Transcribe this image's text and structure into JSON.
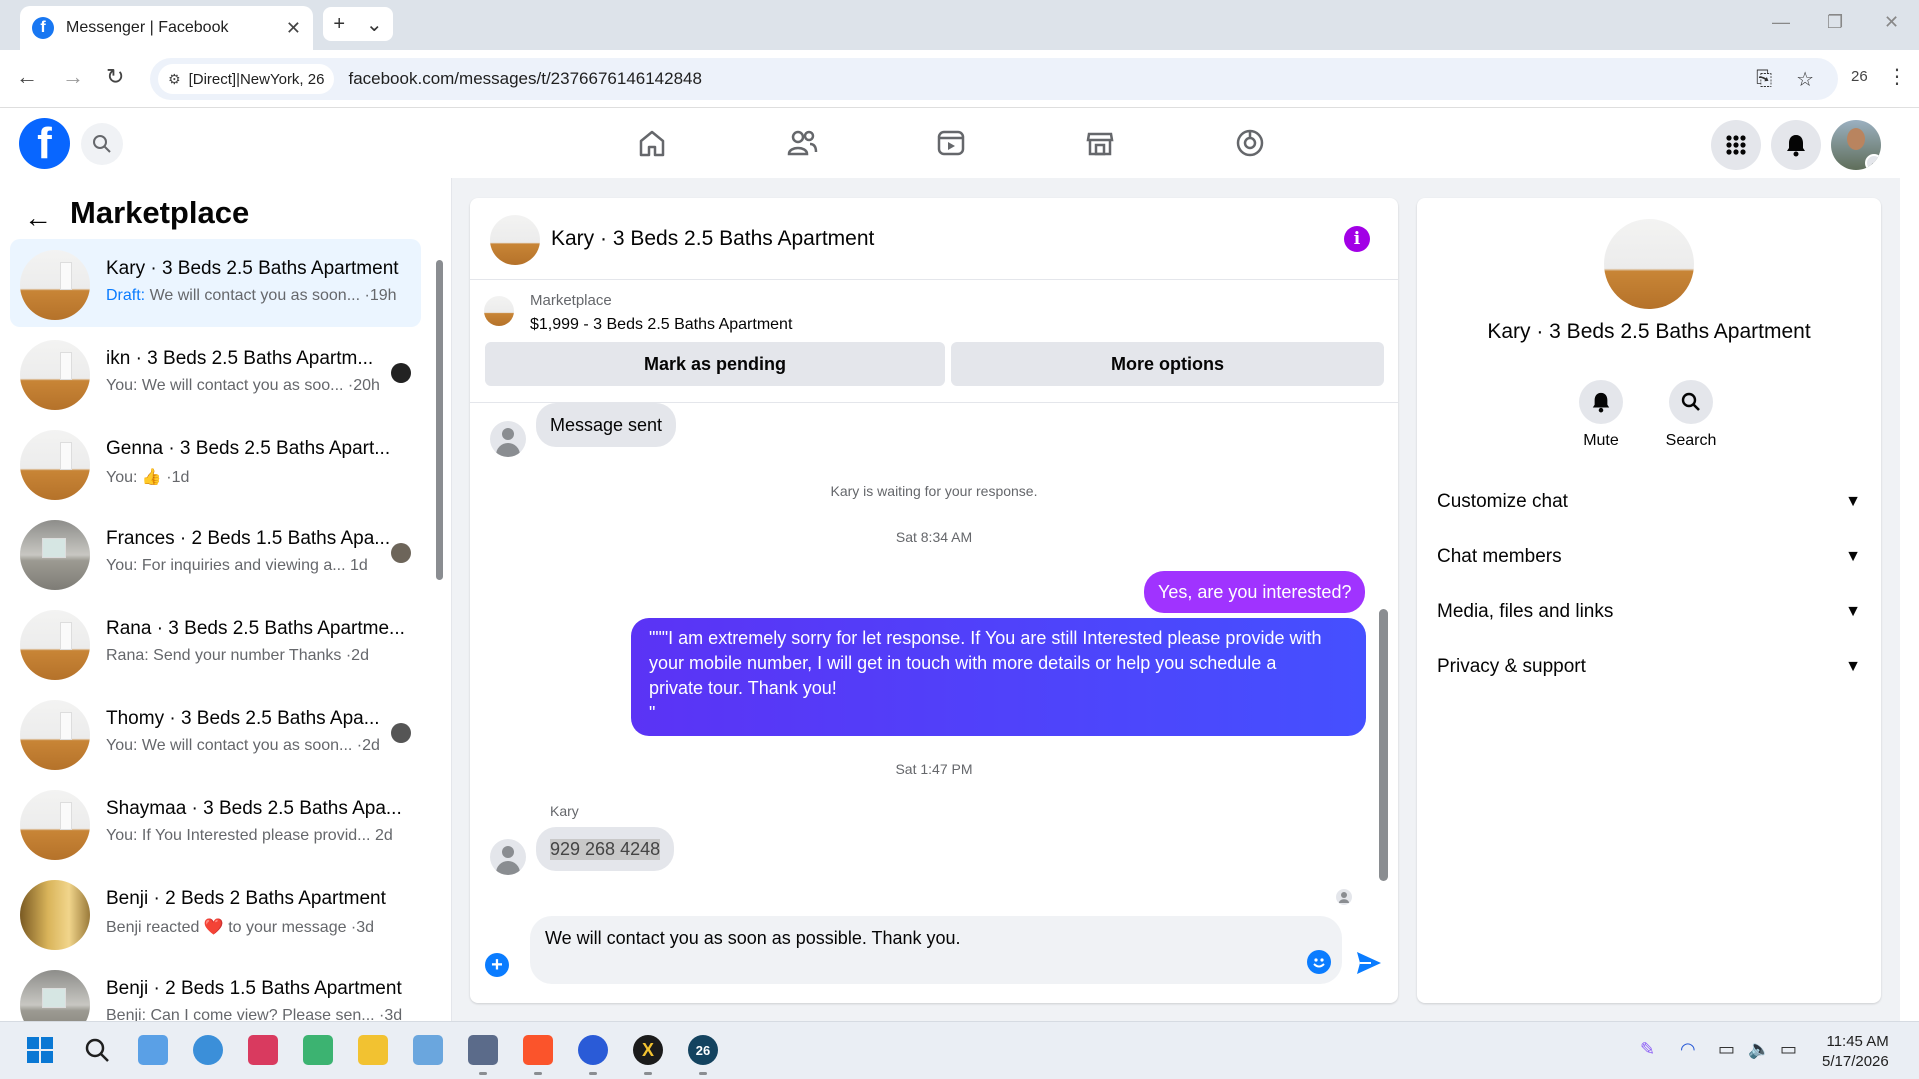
{
  "browser": {
    "tab_title": "Messenger | Facebook",
    "tab_close": "✕",
    "new_tab": "+",
    "tab_menu": "⌄",
    "site_chip": "[Direct]|NewYork, 26",
    "url": "facebook.com/messages/t/2376676146142848",
    "zoom_badge": "26"
  },
  "sidebar": {
    "title": "Marketplace",
    "conversations": [
      {
        "name": "Kary · 3 Beds 2.5 Baths Apartment",
        "preview_prefix": "Draft:",
        "preview": " We will contact you as soon... ·19h",
        "active": true
      },
      {
        "name": "ikn · 3 Beds 2.5 Baths Apartm...",
        "preview_prefix": "",
        "preview": "You: We will contact you as soo... ·20h"
      },
      {
        "name": "Genna · 3 Beds 2.5 Baths Apart...",
        "preview_prefix": "",
        "preview": "You: 👍 ·1d"
      },
      {
        "name": "Frances · 2 Beds 1.5 Baths Apa...",
        "preview_prefix": "",
        "preview": "You: For inquiries and viewing a...   1d"
      },
      {
        "name": "Rana · 3 Beds 2.5 Baths Apartme...",
        "preview_prefix": "",
        "preview": "Rana: Send your number Thanks ·2d"
      },
      {
        "name": "Thomy · 3 Beds 2.5 Baths Apa...",
        "preview_prefix": "",
        "preview": "You: We will contact you as soon... ·2d"
      },
      {
        "name": "Shaymaa · 3 Beds 2.5 Baths Apa...",
        "preview_prefix": "",
        "preview": "You: If You Interested please provid...   2d"
      },
      {
        "name": "Benji · 2 Beds 2 Baths Apartment",
        "preview_prefix": "",
        "preview": "Benji reacted ❤️ to your message ·3d"
      },
      {
        "name": "Benji · 2 Beds 1.5 Baths Apartment",
        "preview_prefix": "",
        "preview": "Benji: Can I come view? Please sen... ·3d"
      }
    ]
  },
  "chat": {
    "title": "Kary · 3 Beds 2.5 Baths Apartment",
    "listing_source": "Marketplace",
    "listing_price_title": "$1,999 - 3 Beds 2.5 Baths Apartment",
    "mark_pending": "Mark as pending",
    "more_options": "More options",
    "msg_sent": "Message sent",
    "waiting": "Kary is waiting for your response.",
    "time1": "Sat 8:34 AM",
    "out_short": "Yes, are you interested?",
    "out_long": "\"\"\"I am extremely sorry for let response. If You are still Interested please provide with\nyour mobile number, I will get in touch with more details or help you schedule a\nprivate tour. Thank you!\n\"",
    "time2": "Sat 1:47 PM",
    "sender_name": "Kary",
    "phone": "929 268 4248",
    "composer_text": "We will contact you as soon as possible. Thank you."
  },
  "info_panel": {
    "name": "Kary · 3 Beds 2.5 Baths Apartment",
    "mute": "Mute",
    "search": "Search",
    "rows": [
      "Customize chat",
      "Chat members",
      "Media, files and links",
      "Privacy & support"
    ]
  },
  "taskbar": {
    "time": "11:45 AM",
    "date": "5/17/2026"
  },
  "colors": {
    "fb_blue": "#0866ff",
    "outgoing_bubble": "#a033ff",
    "info_icon": "#a200e6"
  }
}
